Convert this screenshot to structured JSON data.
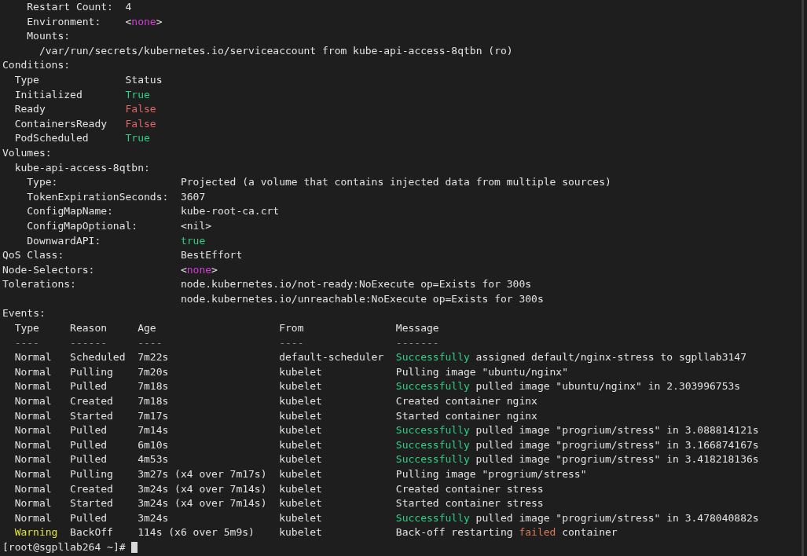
{
  "container": {
    "fields": [
      {
        "label": "Restart Count:",
        "value": "4",
        "kind": "plain"
      },
      {
        "label": "Environment:",
        "value": "<none>",
        "kind": "null"
      }
    ],
    "mounts": {
      "label": "Mounts:",
      "entries": [
        "/var/run/secrets/kubernetes.io/serviceaccount from kube-api-access-8qtbn (ro)"
      ]
    }
  },
  "conditions": {
    "title": "Conditions:",
    "columns": [
      "Type",
      "Status"
    ],
    "rows": [
      {
        "type": "Initialized",
        "status": "True",
        "kind": "success"
      },
      {
        "type": "Ready",
        "status": "False",
        "kind": "failure"
      },
      {
        "type": "ContainersReady",
        "status": "False",
        "kind": "failure"
      },
      {
        "type": "PodScheduled",
        "status": "True",
        "kind": "success"
      }
    ]
  },
  "volumes": {
    "title": "Volumes:",
    "items": [
      {
        "name": "kube-api-access-8qtbn:",
        "fields": [
          {
            "label": "Type:",
            "value": "Projected (a volume that contains injected data from multiple sources)",
            "kind": "plain"
          },
          {
            "label": "TokenExpirationSeconds:",
            "value": "3607",
            "kind": "plain"
          },
          {
            "label": "ConfigMapName:",
            "value": "kube-root-ca.crt",
            "kind": "plain"
          },
          {
            "label": "ConfigMapOptional:",
            "value": "<nil>",
            "kind": "plain"
          },
          {
            "label": "DownwardAPI:",
            "value": "true",
            "kind": "success"
          }
        ]
      }
    ]
  },
  "pod_fields": [
    {
      "label": "QoS Class:",
      "values": [
        "BestEffort"
      ],
      "kind": "plain"
    },
    {
      "label": "Node-Selectors:",
      "values": [
        "<none>"
      ],
      "kind": "null"
    },
    {
      "label": "Tolerations:",
      "values": [
        "node.kubernetes.io/not-ready:NoExecute op=Exists for 300s",
        "node.kubernetes.io/unreachable:NoExecute op=Exists for 300s"
      ],
      "kind": "plain"
    }
  ],
  "events": {
    "title": "Events:",
    "columns": [
      "Type",
      "Reason",
      "Age",
      "From",
      "Message"
    ],
    "rules": [
      "----",
      "------",
      "----",
      "----",
      "-------"
    ],
    "rows": [
      {
        "type": "Normal",
        "kind": "normal",
        "reason": "Scheduled",
        "age": "7m22s",
        "from": "default-scheduler",
        "message": [
          {
            "text": "Successfully",
            "kind": "success"
          },
          {
            "text": "assigned default/nginx-stress to sgpllab3147",
            "kind": "plain"
          }
        ]
      },
      {
        "type": "Normal",
        "kind": "normal",
        "reason": "Pulling",
        "age": "7m20s",
        "from": "kubelet",
        "message": [
          {
            "text": "Pulling image \"ubuntu/nginx\"",
            "kind": "plain"
          }
        ]
      },
      {
        "type": "Normal",
        "kind": "normal",
        "reason": "Pulled",
        "age": "7m18s",
        "from": "kubelet",
        "message": [
          {
            "text": "Successfully",
            "kind": "success"
          },
          {
            "text": "pulled image \"ubuntu/nginx\" in 2.303996753s",
            "kind": "plain"
          }
        ]
      },
      {
        "type": "Normal",
        "kind": "normal",
        "reason": "Created",
        "age": "7m18s",
        "from": "kubelet",
        "message": [
          {
            "text": "Created container nginx",
            "kind": "plain"
          }
        ]
      },
      {
        "type": "Normal",
        "kind": "normal",
        "reason": "Started",
        "age": "7m17s",
        "from": "kubelet",
        "message": [
          {
            "text": "Started container nginx",
            "kind": "plain"
          }
        ]
      },
      {
        "type": "Normal",
        "kind": "normal",
        "reason": "Pulled",
        "age": "7m14s",
        "from": "kubelet",
        "message": [
          {
            "text": "Successfully",
            "kind": "success"
          },
          {
            "text": "pulled image \"progrium/stress\" in 3.088814121s",
            "kind": "plain"
          }
        ]
      },
      {
        "type": "Normal",
        "kind": "normal",
        "reason": "Pulled",
        "age": "6m10s",
        "from": "kubelet",
        "message": [
          {
            "text": "Successfully",
            "kind": "success"
          },
          {
            "text": "pulled image \"progrium/stress\" in 3.166874167s",
            "kind": "plain"
          }
        ]
      },
      {
        "type": "Normal",
        "kind": "normal",
        "reason": "Pulled",
        "age": "4m53s",
        "from": "kubelet",
        "message": [
          {
            "text": "Successfully",
            "kind": "success"
          },
          {
            "text": "pulled image \"progrium/stress\" in 3.418218136s",
            "kind": "plain"
          }
        ]
      },
      {
        "type": "Normal",
        "kind": "normal",
        "reason": "Pulling",
        "age": "3m27s (x4 over 7m17s)",
        "from": "kubelet",
        "message": [
          {
            "text": "Pulling image \"progrium/stress\"",
            "kind": "plain"
          }
        ]
      },
      {
        "type": "Normal",
        "kind": "normal",
        "reason": "Created",
        "age": "3m24s (x4 over 7m14s)",
        "from": "kubelet",
        "message": [
          {
            "text": "Created container stress",
            "kind": "plain"
          }
        ]
      },
      {
        "type": "Normal",
        "kind": "normal",
        "reason": "Started",
        "age": "3m24s (x4 over 7m14s)",
        "from": "kubelet",
        "message": [
          {
            "text": "Started container stress",
            "kind": "plain"
          }
        ]
      },
      {
        "type": "Normal",
        "kind": "normal",
        "reason": "Pulled",
        "age": "3m24s",
        "from": "kubelet",
        "message": [
          {
            "text": "Successfully",
            "kind": "success"
          },
          {
            "text": "pulled image \"progrium/stress\" in 3.478040882s",
            "kind": "plain"
          }
        ]
      },
      {
        "type": "Warning",
        "kind": "warning",
        "reason": "BackOff",
        "age": "114s (x6 over 5m9s)",
        "from": "kubelet",
        "message": [
          {
            "text": "Back-off restarting",
            "kind": "plain"
          },
          {
            "text": "failed",
            "kind": "failure"
          },
          {
            "text": "container",
            "kind": "plain"
          }
        ]
      }
    ]
  },
  "prompt": {
    "text": "[root@sgpllab264 ~]#"
  }
}
